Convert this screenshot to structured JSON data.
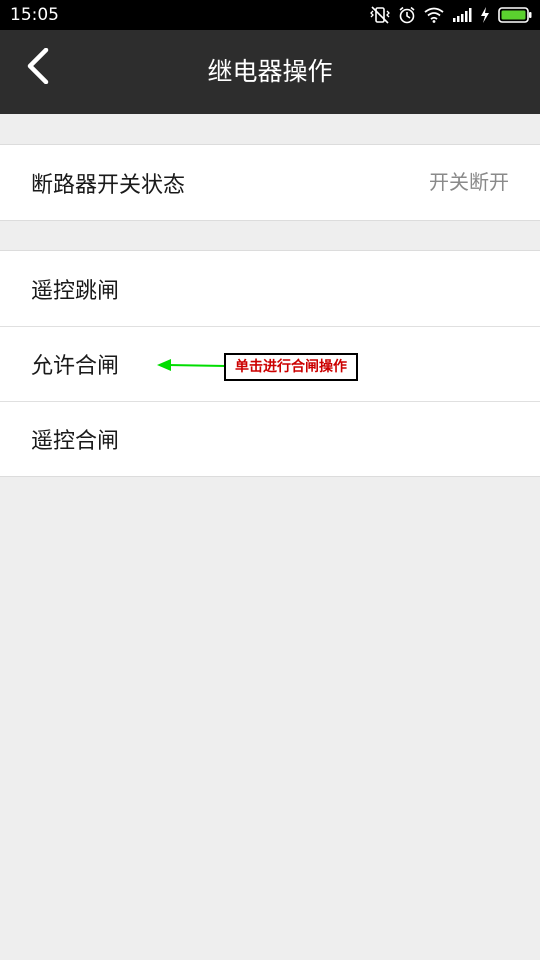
{
  "status_bar": {
    "time": "15:05",
    "icons": [
      "vibrate-off-icon",
      "alarm-icon",
      "wifi-icon",
      "signal-icon",
      "charging-icon",
      "battery-icon"
    ],
    "battery_color": "#5bd12f"
  },
  "nav": {
    "title": "继电器操作",
    "back_icon": "chevron-left-icon",
    "background": "#2d2d2d"
  },
  "status_section": {
    "label": "断路器开关状态",
    "value": "开关断开"
  },
  "operations": [
    {
      "label": "遥控跳闸"
    },
    {
      "label": "允许合闸"
    },
    {
      "label": "遥控合闸"
    }
  ],
  "annotation": {
    "text": "单击进行合闸操作",
    "arrow_color": "#00dd00",
    "text_color": "#cc0000"
  }
}
